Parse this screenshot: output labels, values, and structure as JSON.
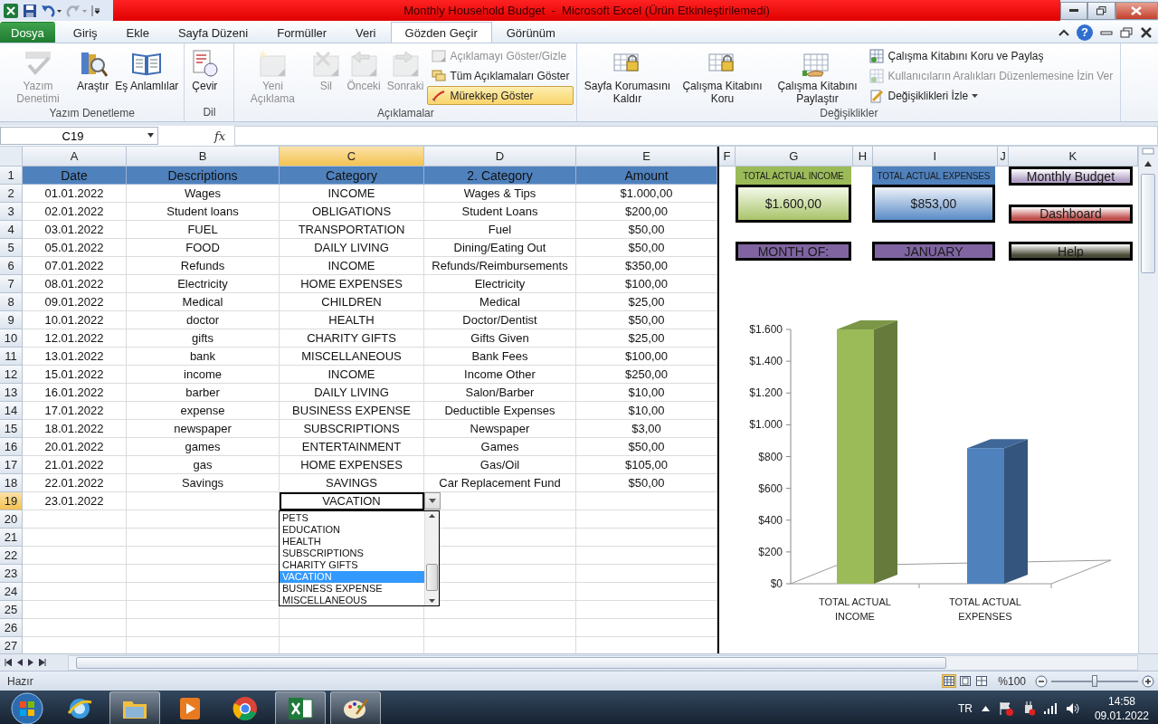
{
  "window": {
    "title": "Monthly Household Budget  -  Microsoft Excel (Ürün Etkinleştirilemedi)"
  },
  "ribbon_tabs": [
    {
      "label": "Dosya",
      "kind": "file",
      "selected": false
    },
    {
      "label": "Giriş",
      "kind": "tab",
      "selected": false
    },
    {
      "label": "Ekle",
      "kind": "tab",
      "selected": false
    },
    {
      "label": "Sayfa Düzeni",
      "kind": "tab",
      "selected": false
    },
    {
      "label": "Formüller",
      "kind": "tab",
      "selected": false
    },
    {
      "label": "Veri",
      "kind": "tab",
      "selected": false
    },
    {
      "label": "Gözden Geçir",
      "kind": "tab",
      "selected": true
    },
    {
      "label": "Görünüm",
      "kind": "tab",
      "selected": false
    }
  ],
  "help": "?",
  "ribbon_groups": [
    {
      "label": "Yazım Denetleme",
      "large_buttons": [
        {
          "label": "Yazım Denetimi",
          "disabled": true
        },
        {
          "label": "Araştır",
          "disabled": false
        },
        {
          "label": "Eş Anlamlılar",
          "disabled": false
        }
      ]
    },
    {
      "label": "Dil",
      "large_buttons": [
        {
          "label": "Çevir",
          "disabled": false
        }
      ]
    },
    {
      "label": "Açıklamalar",
      "large_buttons": [
        {
          "label": "Yeni Açıklama",
          "disabled": true
        },
        {
          "label": "Sil",
          "disabled": true
        },
        {
          "label": "Önceki",
          "disabled": true
        },
        {
          "label": "Sonraki",
          "disabled": true
        }
      ],
      "small_buttons": [
        {
          "label": "Açıklamayı Göster/Gizle",
          "disabled": true,
          "on": false,
          "dropdown": false
        },
        {
          "label": "Tüm Açıklamaları Göster",
          "disabled": false,
          "on": false,
          "dropdown": false
        },
        {
          "label": "Mürekkep Göster",
          "disabled": false,
          "on": true,
          "dropdown": false
        }
      ]
    },
    {
      "label": "Değişiklikler",
      "large_buttons": [
        {
          "label": "Sayfa Korumasını Kaldır",
          "disabled": false
        },
        {
          "label": "Çalışma Kitabını Koru",
          "disabled": false
        },
        {
          "label": "Çalışma Kitabını Paylaştır",
          "disabled": false
        }
      ],
      "small_buttons": [
        {
          "label": "Çalışma Kitabını Koru ve Paylaş",
          "disabled": false,
          "on": false,
          "dropdown": false
        },
        {
          "label": "Kullanıcıların Aralıkları Düzenlemesine İzin Ver",
          "disabled": true,
          "on": false,
          "dropdown": false
        },
        {
          "label": "Değişiklikleri İzle",
          "disabled": false,
          "on": false,
          "dropdown": true
        }
      ]
    }
  ],
  "name_box": "C19",
  "function_button": "fx",
  "sheet": {
    "columns": [
      {
        "label": "A",
        "selected": false
      },
      {
        "label": "B",
        "selected": false
      },
      {
        "label": "C",
        "selected": true
      },
      {
        "label": "D",
        "selected": false
      },
      {
        "label": "E",
        "selected": false
      },
      {
        "label": "F",
        "selected": false
      },
      {
        "label": "G",
        "selected": false
      },
      {
        "label": "H",
        "selected": false
      },
      {
        "label": "I",
        "selected": false
      },
      {
        "label": "J",
        "selected": false
      },
      {
        "label": "K",
        "selected": false
      }
    ],
    "row_numbers": [
      {
        "label": "1",
        "selected": false
      },
      {
        "label": "2",
        "selected": false
      },
      {
        "label": "3",
        "selected": false
      },
      {
        "label": "4",
        "selected": false
      },
      {
        "label": "5",
        "selected": false
      },
      {
        "label": "6",
        "selected": false
      },
      {
        "label": "7",
        "selected": false
      },
      {
        "label": "8",
        "selected": false
      },
      {
        "label": "9",
        "selected": false
      },
      {
        "label": "10",
        "selected": false
      },
      {
        "label": "11",
        "selected": false
      },
      {
        "label": "12",
        "selected": false
      },
      {
        "label": "13",
        "selected": false
      },
      {
        "label": "14",
        "selected": false
      },
      {
        "label": "15",
        "selected": false
      },
      {
        "label": "16",
        "selected": false
      },
      {
        "label": "17",
        "selected": false
      },
      {
        "label": "18",
        "selected": false
      },
      {
        "label": "19",
        "selected": true
      },
      {
        "label": "20",
        "selected": false
      },
      {
        "label": "21",
        "selected": false
      },
      {
        "label": "22",
        "selected": false
      },
      {
        "label": "23",
        "selected": false
      },
      {
        "label": "24",
        "selected": false
      },
      {
        "label": "25",
        "selected": false
      },
      {
        "label": "26",
        "selected": false
      },
      {
        "label": "27",
        "selected": false
      }
    ],
    "header": [
      "Date",
      "Descriptions",
      "Category",
      "2. Category",
      "Amount"
    ],
    "rows": [
      [
        "01.01.2022",
        "Wages",
        "INCOME",
        "Wages & Tips",
        "$1.000,00"
      ],
      [
        "02.01.2022",
        "Student loans",
        "OBLIGATIONS",
        "Student Loans",
        "$200,00"
      ],
      [
        "03.01.2022",
        "FUEL",
        "TRANSPORTATION",
        "Fuel",
        "$50,00"
      ],
      [
        "05.01.2022",
        "FOOD",
        "DAILY LIVING",
        "Dining/Eating Out",
        "$50,00"
      ],
      [
        "07.01.2022",
        "Refunds",
        "INCOME",
        "Refunds/Reimbursements",
        "$350,00"
      ],
      [
        "08.01.2022",
        "Electricity",
        "HOME EXPENSES",
        "Electricity",
        "$100,00"
      ],
      [
        "09.01.2022",
        "Medical",
        "CHILDREN",
        "Medical",
        "$25,00"
      ],
      [
        "10.01.2022",
        "doctor",
        "HEALTH",
        "Doctor/Dentist",
        "$50,00"
      ],
      [
        "12.01.2022",
        "gifts",
        "CHARITY GIFTS",
        "Gifts Given",
        "$25,00"
      ],
      [
        "13.01.2022",
        "bank",
        "MISCELLANEOUS",
        "Bank Fees",
        "$100,00"
      ],
      [
        "15.01.2022",
        "income",
        "INCOME",
        "Income Other",
        "$250,00"
      ],
      [
        "16.01.2022",
        "barber",
        "DAILY LIVING",
        "Salon/Barber",
        "$10,00"
      ],
      [
        "17.01.2022",
        "expense",
        "BUSINESS EXPENSE",
        "Deductible Expenses",
        "$10,00"
      ],
      [
        "18.01.2022",
        "newspaper",
        "SUBSCRIPTIONS",
        "Newspaper",
        "$3,00"
      ],
      [
        "20.01.2022",
        "games",
        "ENTERTAINMENT",
        "Games",
        "$50,00"
      ],
      [
        "21.01.2022",
        "gas",
        "HOME EXPENSES",
        "Gas/Oil",
        "$105,00"
      ],
      [
        "22.01.2022",
        "Savings",
        "SAVINGS",
        "Car Replacement Fund",
        "$50,00"
      ],
      [
        "23.01.2022",
        null,
        "VACATION",
        null,
        null
      ]
    ]
  },
  "dropdown": {
    "options": [
      {
        "label": "PETS",
        "selected": false
      },
      {
        "label": "EDUCATION",
        "selected": false
      },
      {
        "label": "HEALTH",
        "selected": false
      },
      {
        "label": "SUBSCRIPTIONS",
        "selected": false
      },
      {
        "label": "CHARITY GIFTS",
        "selected": false
      },
      {
        "label": "VACATION",
        "selected": true
      },
      {
        "label": "BUSINESS EXPENSE",
        "selected": false
      },
      {
        "label": "MISCELLANEOUS",
        "selected": false
      }
    ]
  },
  "income_card": {
    "label": "TOTAL ACTUAL INCOME",
    "value": "$1.600,00"
  },
  "expenses_card": {
    "label": "TOTAL ACTUAL EXPENSES",
    "value": "$853,00"
  },
  "month_card": {
    "label": "MONTH OF:",
    "value": "JANUARY"
  },
  "nav_buttons": [
    {
      "label": "Monthly Budget",
      "color": "#b3a2c7"
    },
    {
      "label": "Dashboard",
      "color": "#c0504d"
    },
    {
      "label": "Help",
      "color": "#4a4a36"
    }
  ],
  "chart": {
    "chart_data": {
      "type": "bar",
      "categories": [
        "TOTAL ACTUAL INCOME",
        "TOTAL ACTUAL EXPENSES"
      ],
      "series": [
        {
          "color": "#9bbb59",
          "values": [
            1600,
            null
          ]
        },
        {
          "color": "#4f81bd",
          "values": [
            null,
            853
          ]
        }
      ],
      "stacked": true,
      "ylim": [
        0,
        1600
      ],
      "yticks": [
        {
          "value": 0,
          "label": "$0"
        },
        {
          "value": 200,
          "label": "$200"
        },
        {
          "value": 400,
          "label": "$400"
        },
        {
          "value": 600,
          "label": "$600"
        },
        {
          "value": 800,
          "label": "$800"
        },
        {
          "value": 1000,
          "label": "$1.000"
        },
        {
          "value": 1200,
          "label": "$1.200"
        },
        {
          "value": 1400,
          "label": "$1.400"
        },
        {
          "value": 1600,
          "label": "$1.600"
        }
      ]
    }
  },
  "status_bar": {
    "text": "Hazır",
    "views": [
      {
        "selected": true
      },
      {
        "selected": false
      },
      {
        "selected": false
      }
    ],
    "zoom": "%100",
    "zoom_slider": {
      "level": 0.5
    }
  },
  "taskbar": {
    "apps": [
      {
        "running": false
      },
      {
        "running": true
      },
      {
        "running": false
      },
      {
        "running": false
      },
      {
        "running": true
      },
      {
        "running": true
      }
    ],
    "language": "TR",
    "time": "14:58",
    "date": "09.01.2022"
  }
}
